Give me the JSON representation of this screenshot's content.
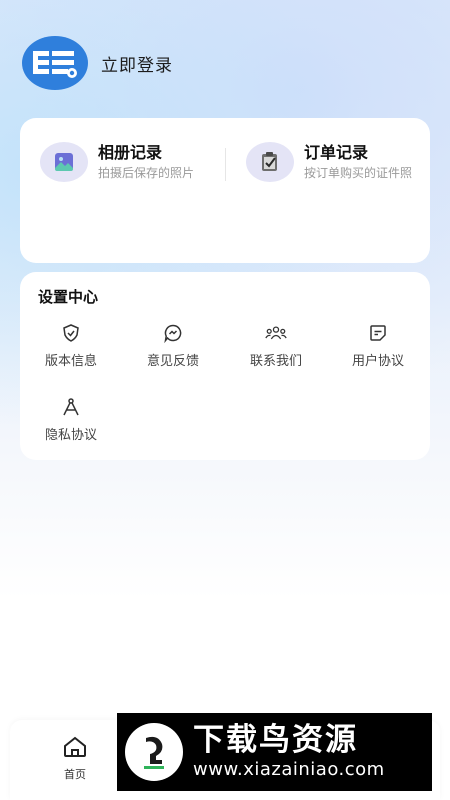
{
  "header": {
    "avatar_icon": "photo-app-logo-icon",
    "login_label": "立即登录"
  },
  "records": {
    "album": {
      "icon": "picture-icon",
      "title": "相册记录",
      "subtitle": "拍摄后保存的照片"
    },
    "order": {
      "icon": "clipboard-check-icon",
      "title": "订单记录",
      "subtitle": "按订单购买的证件照"
    }
  },
  "settings": {
    "title": "设置中心",
    "items": [
      {
        "icon": "shield-check-icon",
        "label": "版本信息"
      },
      {
        "icon": "chat-bubble-icon",
        "label": "意见反馈"
      },
      {
        "icon": "group-icon",
        "label": "联系我们"
      },
      {
        "icon": "sticky-note-icon",
        "label": "用户协议"
      },
      {
        "icon": "compass-icon",
        "label": "隐私协议"
      }
    ]
  },
  "bottom_nav": {
    "items": [
      {
        "icon": "home-icon",
        "label": "首页"
      }
    ]
  },
  "watermark": {
    "title": "下载鸟资源",
    "url": "www.xiazainiao.com"
  },
  "colors": {
    "accent": "#2f7fdc",
    "icon_bg": "#e4e4f6",
    "card": "#ffffff",
    "watermark_bg": "#000000"
  }
}
